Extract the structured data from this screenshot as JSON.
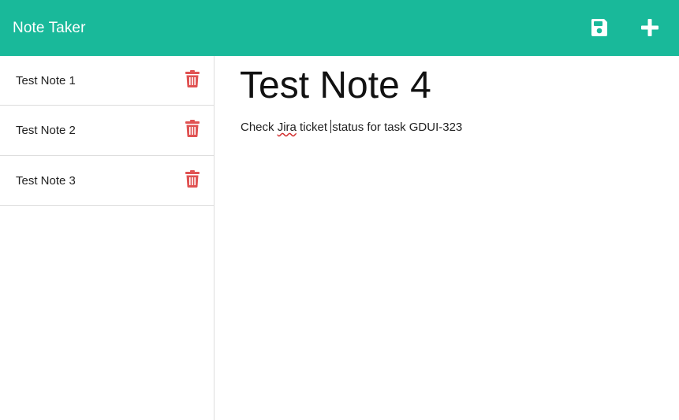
{
  "app": {
    "title": "Note Taker"
  },
  "toolbar": {
    "save_icon": "save-icon",
    "new_icon": "plus-icon"
  },
  "colors": {
    "header": "#19b99a",
    "delete": "#e05252"
  },
  "notes": [
    {
      "title": "Test Note 1",
      "delete_icon": "trash-icon"
    },
    {
      "title": "Test Note 2",
      "delete_icon": "trash-icon"
    },
    {
      "title": "Test Note 3",
      "delete_icon": "trash-icon"
    }
  ],
  "editor": {
    "title": "Test Note 4",
    "body_part1": "Check ",
    "body_misspelled": "Jira",
    "body_part2": " ticket ",
    "body_part3": "status for task GDUI-323"
  }
}
